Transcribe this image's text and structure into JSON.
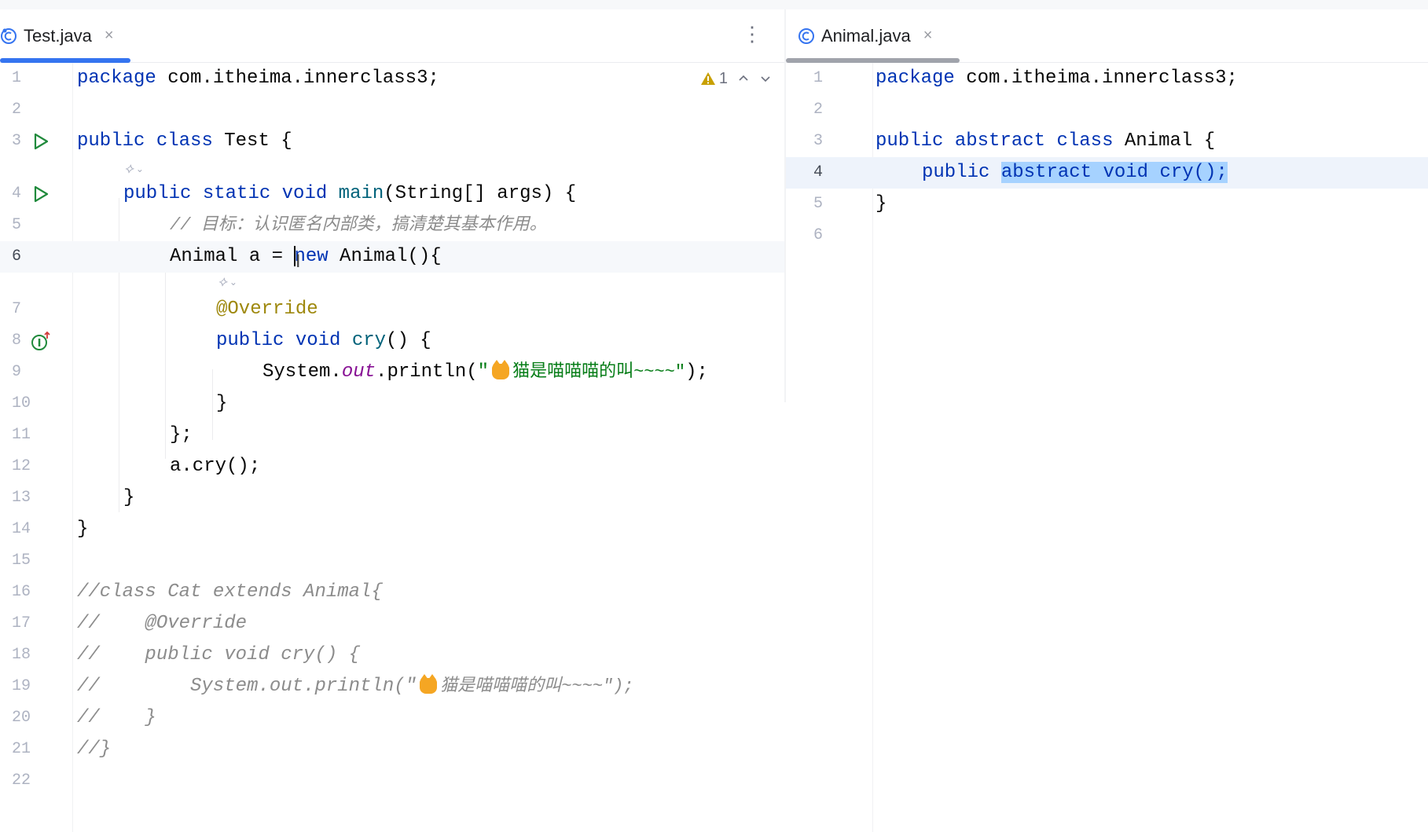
{
  "tabs": {
    "left": {
      "label": "Test.java",
      "close": "×",
      "kebab": "⋮"
    },
    "right": {
      "label": "Animal.java",
      "close": "×"
    }
  },
  "colors": {
    "keyword": "#0033b3",
    "string": "#067d17",
    "annotation": "#9e880d",
    "static_field": "#871094",
    "comment": "#8c8c8c",
    "selection": "#a6d2ff",
    "active_tab_underline": "#3574f0",
    "inactive_tab_underline": "#a0a3ab",
    "run_icon": "#208a3c",
    "warning": "#c8a000"
  },
  "left_editor": {
    "inspection": {
      "icon": "warning-icon",
      "count": "1"
    },
    "caret_line": 6,
    "line_numbers": [
      "1",
      "2",
      "3",
      "4",
      "5",
      "6",
      "7",
      "8",
      "9",
      "10",
      "11",
      "12",
      "13",
      "14",
      "15",
      "16",
      "17",
      "18",
      "19",
      "20",
      "21",
      "22"
    ],
    "lines": {
      "l1": [
        "package",
        " com.itheima.innerclass3;"
      ],
      "l3": [
        "public",
        " ",
        "class",
        " Test {"
      ],
      "l4": [
        "public",
        " ",
        "static",
        " ",
        "void",
        " main",
        "(String[] args) {"
      ],
      "l5": "// 目标：认识匿名内部类，搞清楚其基本作用。",
      "l6": [
        "Animal a = ",
        "new",
        " Animal(){"
      ],
      "l7": "@Override",
      "l8": [
        "public",
        " ",
        "void",
        " cry",
        "() {"
      ],
      "l9": [
        "System.",
        "out",
        ".println(",
        "\"",
        "猫是喵喵喵的叫~~~~\"",
        ");"
      ],
      "l10": "}",
      "l11": "};",
      "l12": "a.cry();",
      "l13": "}",
      "l14": "}",
      "l16": "//class Cat extends Animal{",
      "l17": "//    @Override",
      "l18": "//    public void cry() {",
      "l19": [
        "//        System.out.println(\"",
        "猫是喵喵喵的叫~~~~\");"
      ],
      "l20": "//    }",
      "l21": "//}"
    }
  },
  "right_editor": {
    "caret_line": 4,
    "line_numbers": [
      "1",
      "2",
      "3",
      "4",
      "5",
      "6"
    ],
    "lines": {
      "l1": [
        "package",
        " com.itheima.innerclass3;"
      ],
      "l3": [
        "public",
        " ",
        "abstract",
        " ",
        "class",
        " Animal {"
      ],
      "l4": [
        "public",
        " ",
        "abstract void cry();"
      ],
      "l5": "}"
    }
  }
}
